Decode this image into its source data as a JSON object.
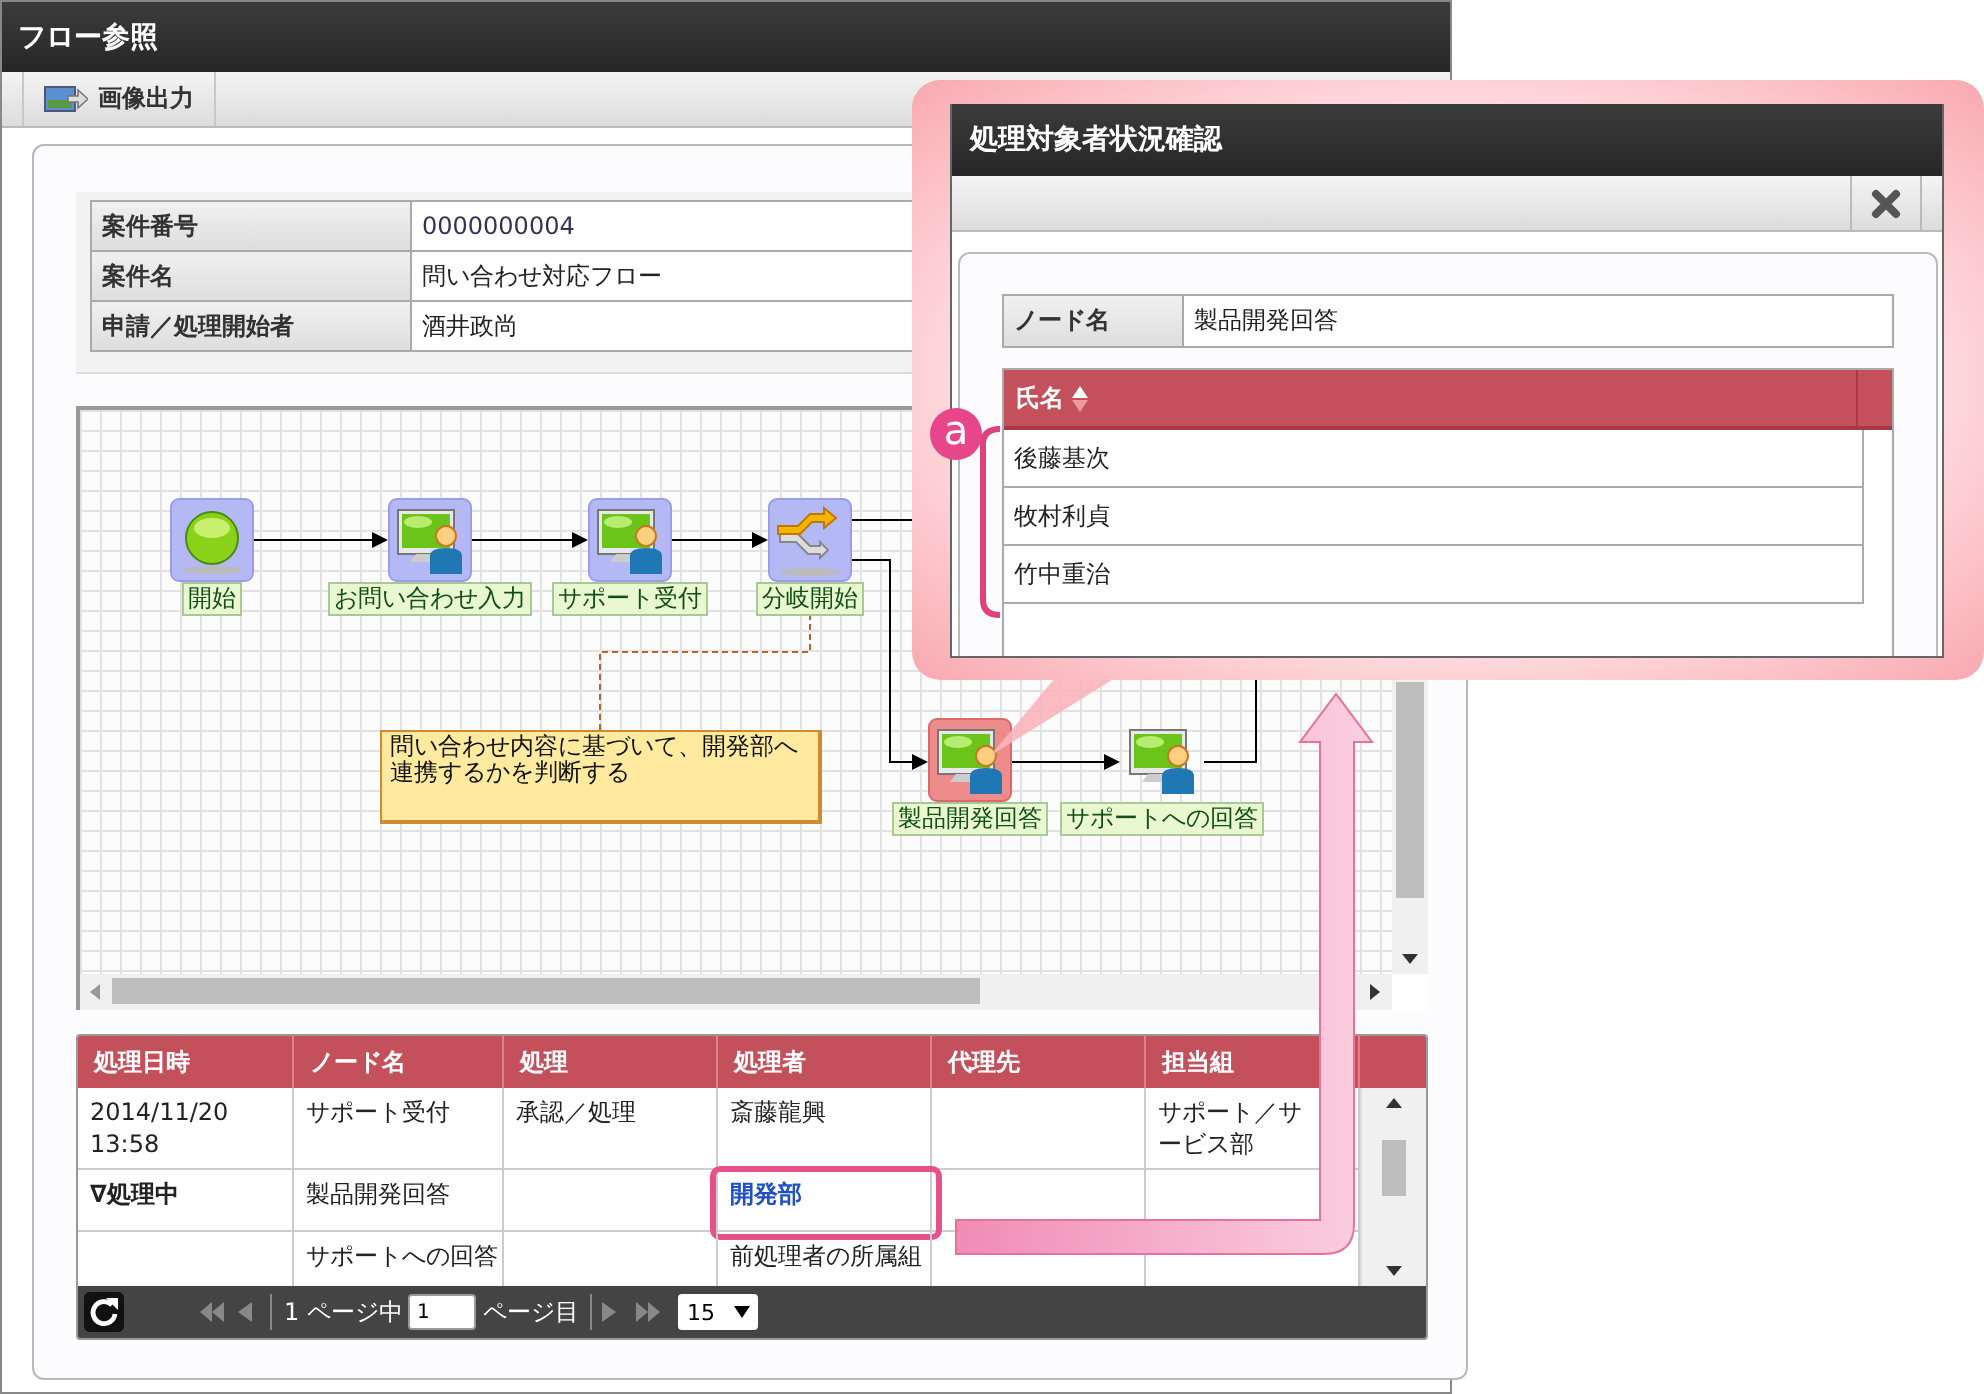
{
  "window": {
    "title": "フロー参照"
  },
  "toolbar": {
    "buttons": [
      {
        "label": "画像出力"
      }
    ]
  },
  "case_info": [
    {
      "label": "案件番号",
      "value": "0000000004"
    },
    {
      "label": "案件名",
      "value": "問い合わせ対応フロー"
    },
    {
      "label": "申請／処理開始者",
      "value": "酒井政尚"
    }
  ],
  "flow": {
    "nodes": [
      {
        "kind": "start",
        "label": "開始",
        "visited": true,
        "selected": false
      },
      {
        "kind": "user",
        "label": "お問い合わせ入力",
        "visited": true,
        "selected": false
      },
      {
        "kind": "user",
        "label": "サポート受付",
        "visited": true,
        "selected": false
      },
      {
        "kind": "branch",
        "label": "分岐開始",
        "visited": true,
        "selected": false
      },
      {
        "kind": "user",
        "label": "製品開発回答",
        "selected": true
      },
      {
        "kind": "user",
        "label": "サポートへの回答",
        "visited": false,
        "selected": false
      }
    ],
    "note": "問い合わせ内容に基づいて、開発部へ連携するかを判断する"
  },
  "history": {
    "columns": [
      "処理日時",
      "ノード名",
      "処理",
      "処理者",
      "代理先",
      "担当組"
    ],
    "rows": [
      {
        "cells": [
          {
            "kind": "text",
            "text": "2014/11/20\n13:58"
          },
          {
            "kind": "text",
            "text": "サポート受付"
          },
          {
            "kind": "text",
            "text": "承認／処理"
          },
          {
            "kind": "text",
            "text": "斎藤龍興"
          },
          null,
          {
            "kind": "text",
            "text": "サポート／サービス部"
          }
        ]
      },
      {
        "cells": [
          {
            "kind": "status",
            "text": "∇処理中"
          },
          {
            "kind": "text",
            "text": "製品開発回答"
          },
          null,
          {
            "kind": "link",
            "text": "開発部",
            "callout": true
          },
          null,
          null
        ]
      },
      {
        "cells": [
          null,
          {
            "kind": "text",
            "text": "サポートへの回答"
          },
          null,
          {
            "kind": "text",
            "text": "前処理者の所属組"
          },
          null,
          null
        ]
      }
    ],
    "pager": {
      "page_prefix": "1 ページ中",
      "page": "1",
      "page_suffix": "ページ目",
      "page_size": "15"
    }
  },
  "popup": {
    "title": "処理対象者状況確認",
    "node_label": "ノード名",
    "node_value": "製品開発回答",
    "column": "氏名",
    "rows": [
      "後藤基次",
      "牧村利貞",
      "竹中重治"
    ],
    "marker": "a"
  }
}
